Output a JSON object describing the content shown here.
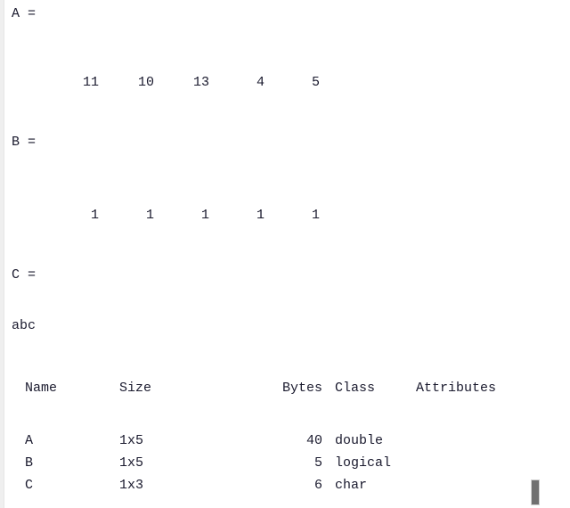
{
  "console": {
    "background_color": "#ffffff",
    "text_color": "#1a1a2e",
    "gutter_color": "#efefef",
    "cursor_color": "#707070"
  },
  "outputs": [
    {
      "label": "A =",
      "values": [
        "11",
        "10",
        "13",
        "4",
        "5"
      ]
    },
    {
      "label": "B =",
      "values": [
        "1",
        "1",
        "1",
        "1",
        "1"
      ]
    }
  ],
  "char_output": {
    "label": "C =",
    "value": "abc"
  },
  "whos_table": {
    "headers": {
      "name": "Name",
      "size": "Size",
      "bytes": "Bytes",
      "class": "Class",
      "attributes": "Attributes"
    },
    "rows": [
      {
        "name": "A",
        "size": "1x5",
        "bytes": "40",
        "class": "double",
        "attributes": ""
      },
      {
        "name": "B",
        "size": "1x5",
        "bytes": "5",
        "class": "logical",
        "attributes": ""
      },
      {
        "name": "C",
        "size": "1x3",
        "bytes": "6",
        "class": "char",
        "attributes": ""
      }
    ]
  }
}
